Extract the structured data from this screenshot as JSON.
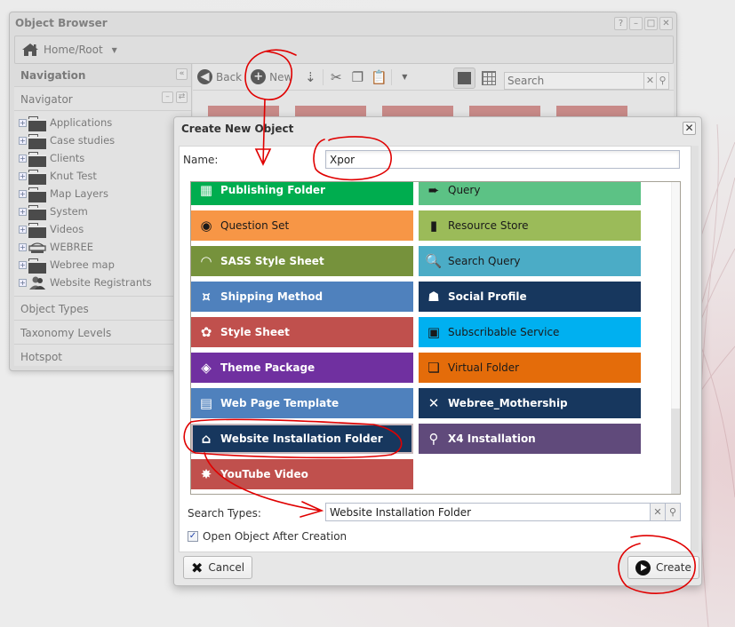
{
  "object_browser": {
    "title": "Object Browser",
    "window_buttons": [
      "?",
      "–",
      "□",
      "✕"
    ],
    "breadcrumb": {
      "icon": "home-icon",
      "label": "Home/Root"
    },
    "navigation": {
      "header": "Navigation",
      "navigator_label": "Navigator",
      "tree": [
        {
          "label": "Applications",
          "icon": "folder-icon"
        },
        {
          "label": "Case studies",
          "icon": "folder-icon"
        },
        {
          "label": "Clients",
          "icon": "folder-icon"
        },
        {
          "label": "Knut Test",
          "icon": "folder-icon"
        },
        {
          "label": "Map Layers",
          "icon": "folder-icon"
        },
        {
          "label": "System",
          "icon": "folder-icon"
        },
        {
          "label": "Videos",
          "icon": "folder-icon"
        },
        {
          "label": "WEBREE",
          "icon": "website-icon"
        },
        {
          "label": "Webree map",
          "icon": "folder-icon"
        },
        {
          "label": "Website Registrants",
          "icon": "users-icon"
        }
      ],
      "sections": [
        "Object Types",
        "Taxonomy Levels",
        "Hotspot"
      ]
    },
    "toolbar": {
      "back_label": "Back",
      "new_label": "New",
      "search_placeholder": "Search"
    }
  },
  "dialog": {
    "title": "Create New Object",
    "name_label": "Name:",
    "name_value": "Xpor",
    "types_left": [
      {
        "label": "Publishing Folder",
        "icon": "calendar-icon",
        "color": "#00ad4f",
        "text": "light"
      },
      {
        "label": "Question Set",
        "icon": "fingerprint-icon",
        "color": "#f79646",
        "text": "dark"
      },
      {
        "label": "SASS Style Sheet",
        "icon": "rainbow-icon",
        "color": "#76923c",
        "text": "light"
      },
      {
        "label": "Shipping Method",
        "icon": "shipping-icon",
        "color": "#4f81bd",
        "text": "light"
      },
      {
        "label": "Style Sheet",
        "icon": "palette-icon",
        "color": "#c0504d",
        "text": "light"
      },
      {
        "label": "Theme Package",
        "icon": "theme-icon",
        "color": "#7030a0",
        "text": "light"
      },
      {
        "label": "Web Page Template",
        "icon": "template-icon",
        "color": "#4f81bd",
        "text": "light"
      },
      {
        "label": "Website Installation Folder",
        "icon": "website-icon",
        "color": "#17375e",
        "text": "light",
        "selected": true
      },
      {
        "label": "YouTube Video",
        "icon": "video-icon",
        "color": "#c0504d",
        "text": "light"
      }
    ],
    "types_right": [
      {
        "label": "Query",
        "icon": "arrow-icon",
        "color": "#5cc285",
        "text": "dark"
      },
      {
        "label": "Resource Store",
        "icon": "notebook-icon",
        "color": "#9bbb59",
        "text": "dark"
      },
      {
        "label": "Search Query",
        "icon": "search-query-icon",
        "color": "#4bacc6",
        "text": "dark"
      },
      {
        "label": "Social Profile",
        "icon": "user-icon",
        "color": "#17375e",
        "text": "light"
      },
      {
        "label": "Subscribable Service",
        "icon": "gift-icon",
        "color": "#00b0f0",
        "text": "dark"
      },
      {
        "label": "Virtual Folder",
        "icon": "stack-icon",
        "color": "#e46c0a",
        "text": "dark"
      },
      {
        "label": "Webree_Mothership",
        "icon": "x-icon",
        "color": "#17375e",
        "text": "light"
      },
      {
        "label": "X4 Installation",
        "icon": "magnifier-icon",
        "color": "#604a7b",
        "text": "light"
      }
    ],
    "search_types_label": "Search Types:",
    "search_types_value": "Website Installation Folder",
    "open_after_label": "Open Object After Creation",
    "open_after_checked": true,
    "cancel_label": "Cancel",
    "create_label": "Create"
  }
}
